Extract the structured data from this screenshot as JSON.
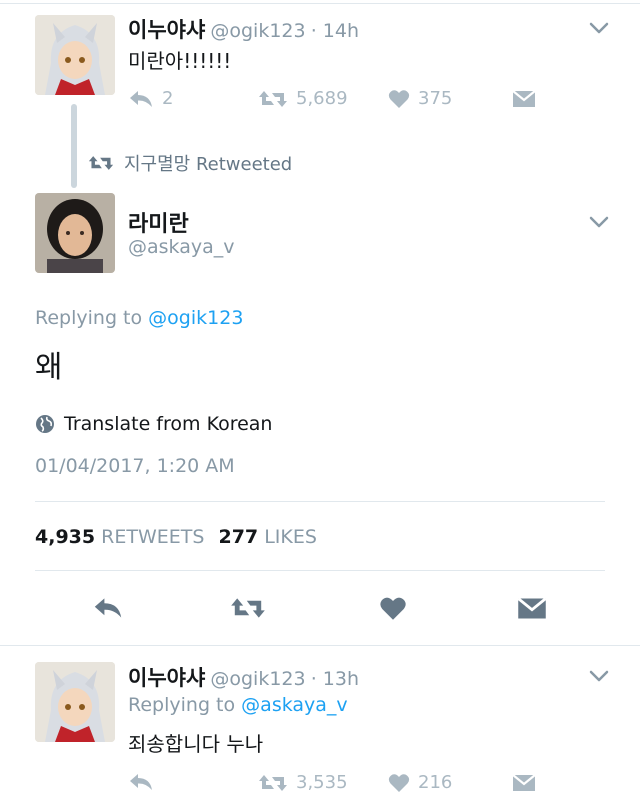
{
  "tweet1": {
    "name": "이누야샤",
    "handle": "@ogik123",
    "time": "· 14h",
    "text": "미란아!!!!!!",
    "replies": "2",
    "retweets": "5,689",
    "likes": "375"
  },
  "retweet_note": "지구멸망 Retweeted",
  "tweet2": {
    "name": "라미란",
    "handle": "@askaya_v",
    "replying_prefix": "Replying to",
    "replying_to": "@ogik123",
    "text": "왜",
    "translate": "Translate from Korean",
    "timestamp": "01/04/2017, 1:20 AM",
    "retweet_count": "4,935",
    "retweet_label": "RETWEETS",
    "like_count": "277",
    "like_label": "LIKES"
  },
  "tweet3": {
    "name": "이누야샤",
    "handle": "@ogik123",
    "time": "· 13h",
    "replying_prefix": "Replying to",
    "replying_to": "@askaya_v",
    "text": "죄송합니다 누나",
    "retweets": "3,535",
    "likes": "216"
  },
  "colors": {
    "link": "#1da1f2",
    "muted": "#8899a6",
    "icon": "#aab8c2",
    "icon_dark": "#657786",
    "divider": "#e1e8ed"
  },
  "icons": [
    "reply-icon",
    "retweet-icon",
    "like-icon",
    "message-icon",
    "chevron-down-icon",
    "globe-icon"
  ]
}
